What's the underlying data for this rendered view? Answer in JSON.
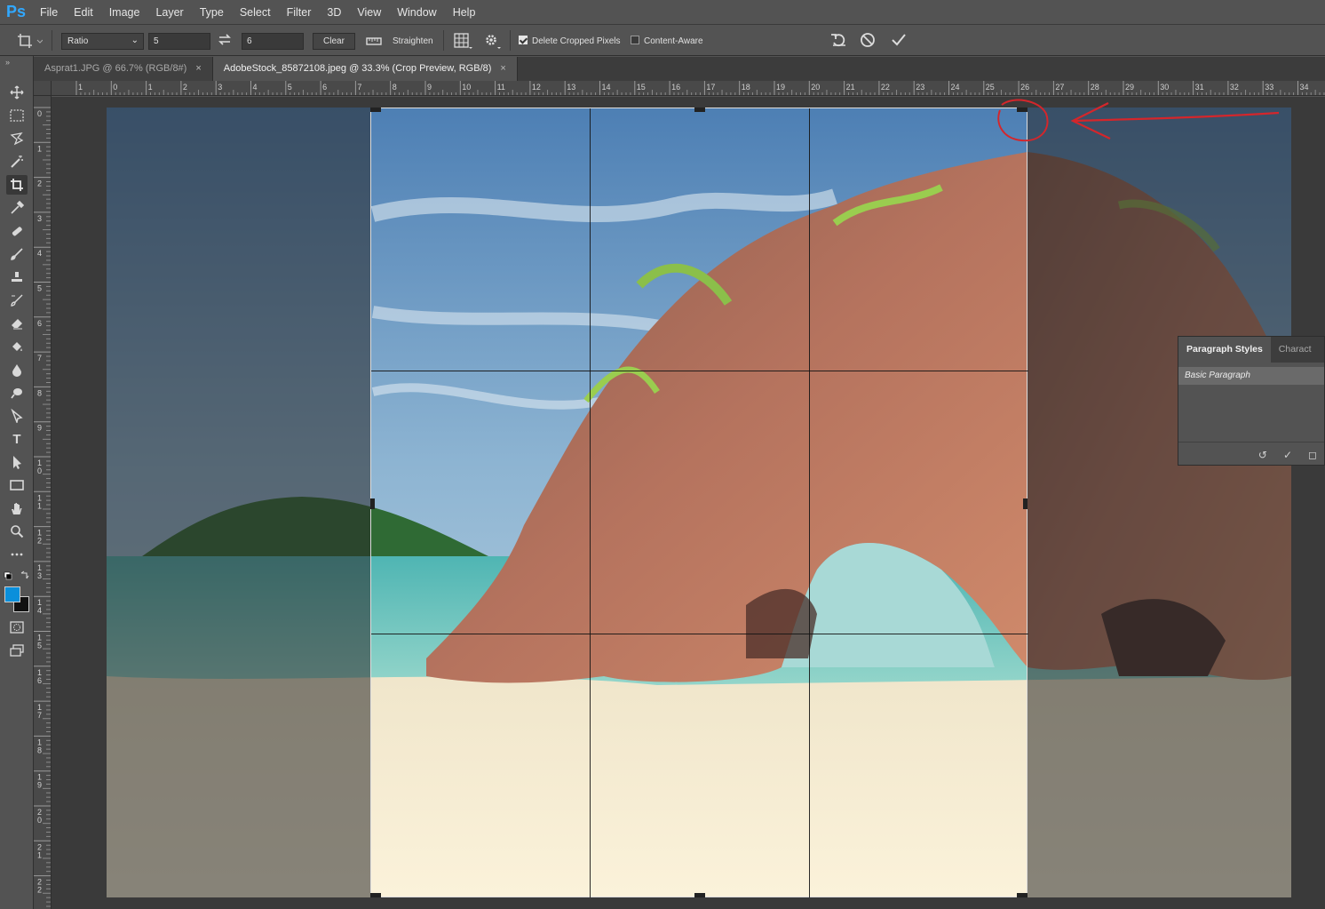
{
  "app": {
    "logo": "Ps"
  },
  "menu": [
    "File",
    "Edit",
    "Image",
    "Layer",
    "Type",
    "Select",
    "Filter",
    "3D",
    "View",
    "Window",
    "Help"
  ],
  "options": {
    "ratio_select": "Ratio",
    "width_value": "5",
    "height_value": "6",
    "clear_label": "Clear",
    "straighten_label": "Straighten",
    "delete_cropped_label": "Delete Cropped Pixels",
    "delete_cropped_checked": true,
    "content_aware_label": "Content-Aware",
    "content_aware_checked": false
  },
  "tabs": [
    {
      "label": "Asprat1.JPG @ 66.7% (RGB/8#)",
      "active": false
    },
    {
      "label": "AdobeStock_85872108.jpeg @ 33.3% (Crop Preview, RGB/8)",
      "active": true
    }
  ],
  "ruler_top": [
    "1",
    "0",
    "1",
    "2",
    "3",
    "4",
    "5",
    "6",
    "7",
    "8",
    "9",
    "10",
    "11",
    "12",
    "13",
    "14",
    "15",
    "16",
    "17",
    "18",
    "19",
    "20",
    "21",
    "22",
    "23",
    "24",
    "25",
    "26",
    "27",
    "28",
    "29",
    "30",
    "31",
    "32",
    "33",
    "34"
  ],
  "ruler_left": [
    "0",
    "1",
    "2",
    "3",
    "4",
    "5",
    "6",
    "7",
    "8",
    "9",
    "10",
    "11",
    "12",
    "13",
    "14",
    "15",
    "16",
    "17",
    "18",
    "19",
    "20",
    "21",
    "22"
  ],
  "tools": [
    "move-tool",
    "marquee-tool",
    "lasso-tool",
    "magic-wand-tool",
    "crop-tool",
    "eyedropper-tool",
    "healing-brush-tool",
    "brush-tool",
    "stamp-tool",
    "history-brush-tool",
    "eraser-tool",
    "paint-bucket-tool",
    "blur-tool",
    "dodge-tool",
    "pen-tool",
    "type-tool",
    "path-selection-tool",
    "rectangle-tool",
    "hand-tool",
    "zoom-tool",
    "more-tools"
  ],
  "colors": {
    "foreground": "#0a8fdb",
    "background": "#111111"
  },
  "panel": {
    "tab_active": "Paragraph Styles",
    "tab_other": "Charact",
    "item": "Basic Paragraph"
  }
}
